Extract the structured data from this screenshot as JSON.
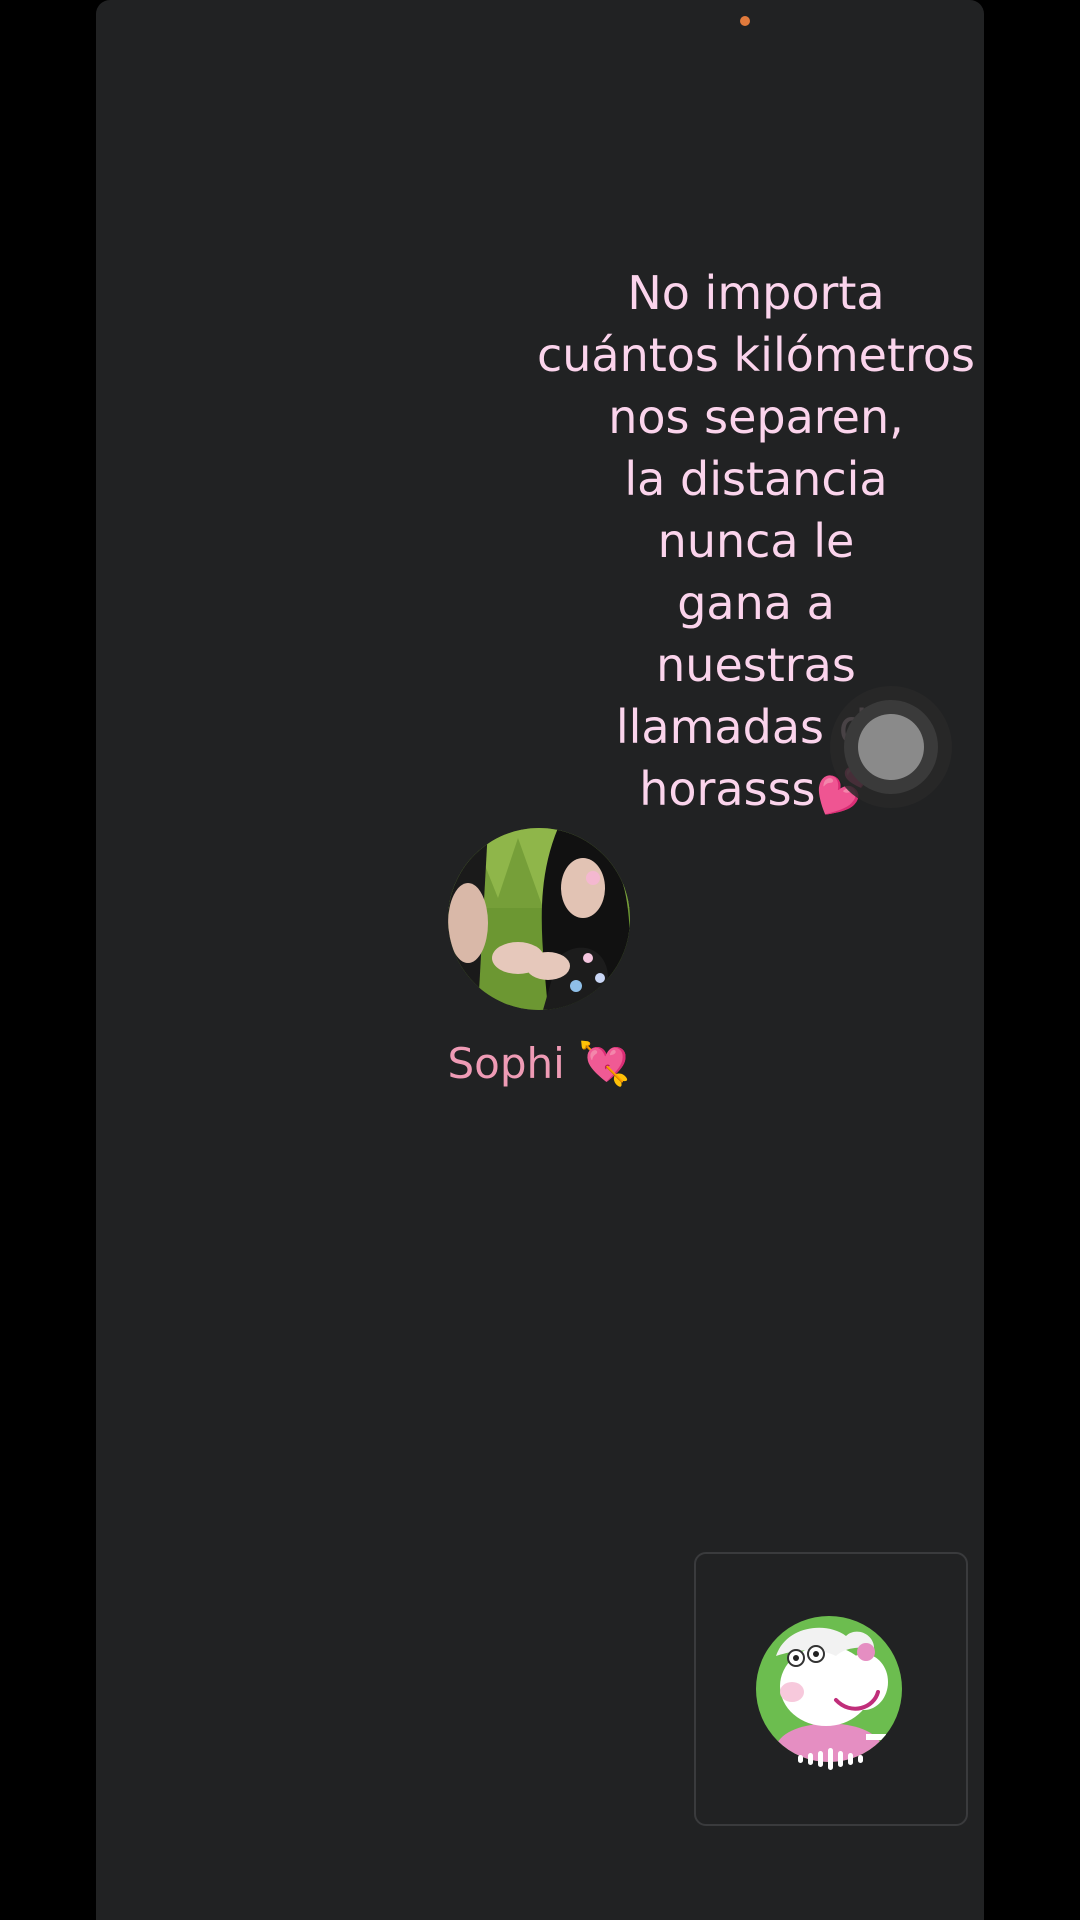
{
  "overlay": {
    "lines": [
      "No importa",
      "cuántos kilómetros",
      "nos separen,",
      "la distancia",
      "nunca le",
      "gana a",
      "nuestras",
      "llamadas de",
      "horasss💕"
    ]
  },
  "call": {
    "caller_name": "Sophi 💘"
  },
  "icons": {
    "assistive_touch": "assistive-touch-icon",
    "remote_avatar": "caller-avatar-photo",
    "self_avatar": "sheep-character-avatar",
    "audio_level": "audio-wave-icon"
  },
  "colors": {
    "background": "#212223",
    "overlay_text": "#fbd4ec",
    "caller_name": "#ef9bb5",
    "camera_indicator": "#e07a3c"
  }
}
